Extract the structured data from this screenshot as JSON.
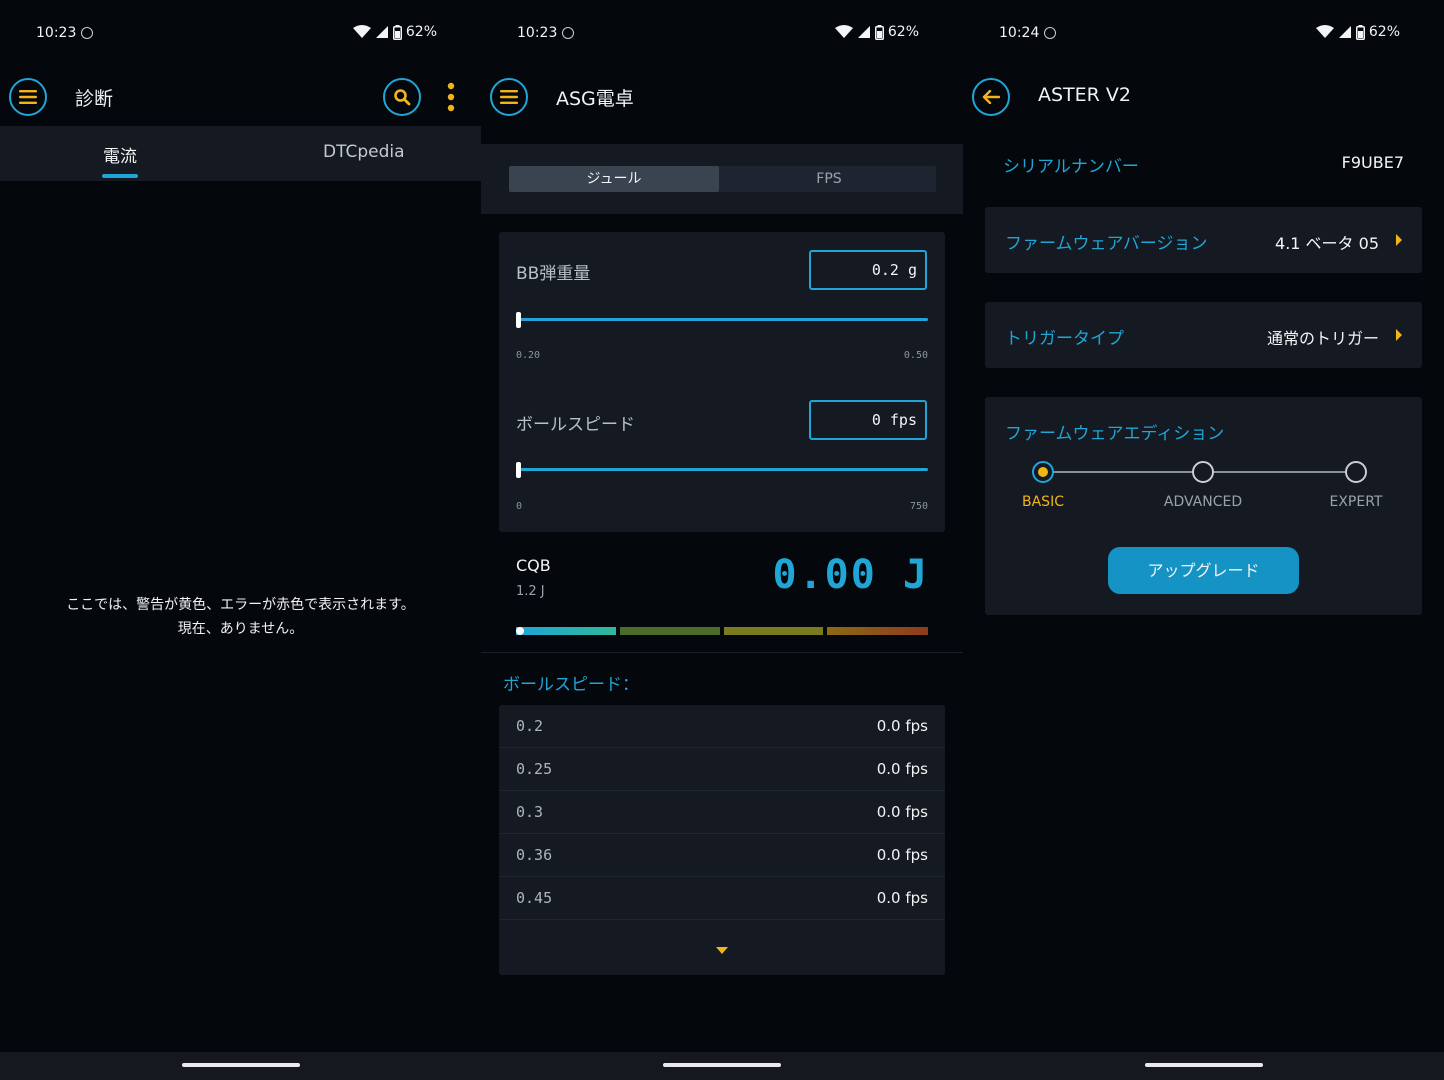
{
  "screen1": {
    "status": {
      "time": "10:23",
      "battery": "62%"
    },
    "title": "診断",
    "tabs": [
      {
        "label": "電流"
      },
      {
        "label": "DTCpedia"
      }
    ],
    "message_line1": "ここでは、警告が黄色、エラーが赤色で表示されます。",
    "message_line2": "現在、ありません。"
  },
  "screen2": {
    "status": {
      "time": "10:23",
      "battery": "62%"
    },
    "title": "ASG電卓",
    "segments": [
      {
        "label": "ジュール"
      },
      {
        "label": "FPS"
      }
    ],
    "bb_weight": {
      "label": "BB弾重量",
      "value": "0.2 g",
      "min": "0.20",
      "max": "0.50",
      "position": 0.0
    },
    "ball_speed": {
      "label": "ボールスピード",
      "value": "0 fps",
      "min": "0",
      "max": "750",
      "position": 0.0
    },
    "cqb": {
      "label": "CQB",
      "limit": "1.2 J",
      "energy": "0.00 J"
    },
    "meter_colors": [
      "#1fa6d6",
      "#2fb89a",
      "#4a6b2a",
      "#7a7a1e",
      "#8a6a14",
      "#8f3a1e"
    ],
    "list_title": "ボールスピード：",
    "list": [
      {
        "weight": "0.2",
        "speed": "0.0 fps"
      },
      {
        "weight": "0.25",
        "speed": "0.0 fps"
      },
      {
        "weight": "0.3",
        "speed": "0.0 fps"
      },
      {
        "weight": "0.36",
        "speed": "0.0 fps"
      },
      {
        "weight": "0.45",
        "speed": "0.0 fps"
      }
    ]
  },
  "screen3": {
    "status": {
      "time": "10:24",
      "battery": "62%"
    },
    "title": "ASTER V2",
    "serial": {
      "label": "シリアルナンバー",
      "value": "F9UBE7"
    },
    "firmware_version": {
      "label": "ファームウェアバージョン",
      "value": "4.1 ベータ 05"
    },
    "trigger_type": {
      "label": "トリガータイプ",
      "value": "通常のトリガー"
    },
    "edition": {
      "label": "ファームウェアエディション",
      "steps": [
        "BASIC",
        "ADVANCED",
        "EXPERT"
      ],
      "selected": "BASIC"
    },
    "upgrade_label": "アップグレード"
  },
  "colors": {
    "accent": "#1fa6d6",
    "highlight": "#f2b519",
    "card": "#141922",
    "background": "#04070b"
  }
}
